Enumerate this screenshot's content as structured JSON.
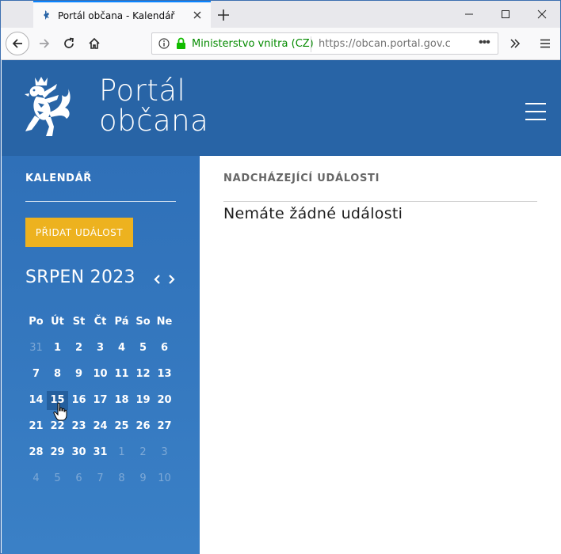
{
  "browser": {
    "tab_title": "Portál občana - Kalendář",
    "site_owner": "Ministerstvo vnitra (CZ)",
    "url": "https://obcan.portal.gov.cz/",
    "more_dots": "•••"
  },
  "header": {
    "title_line1": "Portál",
    "title_line2": "občana"
  },
  "sidebar": {
    "heading": "KALENDÁŘ",
    "add_button": "PŘIDAT UDÁLOST",
    "month_label": "SRPEN 2023",
    "weekdays": [
      "Po",
      "Út",
      "St",
      "Čt",
      "Pá",
      "So",
      "Ne"
    ],
    "weeks": [
      [
        {
          "d": "31",
          "m": true
        },
        {
          "d": "1"
        },
        {
          "d": "2"
        },
        {
          "d": "3"
        },
        {
          "d": "4"
        },
        {
          "d": "5"
        },
        {
          "d": "6"
        }
      ],
      [
        {
          "d": "7"
        },
        {
          "d": "8"
        },
        {
          "d": "9"
        },
        {
          "d": "10"
        },
        {
          "d": "11"
        },
        {
          "d": "12"
        },
        {
          "d": "13"
        }
      ],
      [
        {
          "d": "14"
        },
        {
          "d": "15",
          "sel": true
        },
        {
          "d": "16"
        },
        {
          "d": "17"
        },
        {
          "d": "18"
        },
        {
          "d": "19"
        },
        {
          "d": "20"
        }
      ],
      [
        {
          "d": "21"
        },
        {
          "d": "22"
        },
        {
          "d": "23"
        },
        {
          "d": "24"
        },
        {
          "d": "25"
        },
        {
          "d": "26"
        },
        {
          "d": "27"
        }
      ],
      [
        {
          "d": "28"
        },
        {
          "d": "29"
        },
        {
          "d": "30"
        },
        {
          "d": "31"
        },
        {
          "d": "1",
          "m": true
        },
        {
          "d": "2",
          "m": true
        },
        {
          "d": "3",
          "m": true
        }
      ],
      [
        {
          "d": "4",
          "m": true
        },
        {
          "d": "5",
          "m": true
        },
        {
          "d": "6",
          "m": true
        },
        {
          "d": "7",
          "m": true
        },
        {
          "d": "8",
          "m": true
        },
        {
          "d": "9",
          "m": true
        },
        {
          "d": "10",
          "m": true
        }
      ]
    ]
  },
  "main": {
    "heading": "NADCHÁZEJÍCÍ UDÁLOSTI",
    "empty_message": "Nemáte žádné události"
  },
  "colors": {
    "header_blue": "#2864a6",
    "sidebar_blue": "#2f70b8",
    "accent_yellow": "#edb21f",
    "secure_green": "#058b00"
  },
  "icons": [
    "lion-logo-icon",
    "hamburger-menu-icon",
    "chevron-left-icon",
    "chevron-right-icon",
    "lock-icon",
    "info-icon",
    "back-icon",
    "forward-icon",
    "reload-icon",
    "home-icon",
    "overflow-icon",
    "menu-icon",
    "close-icon",
    "minimize-icon",
    "maximize-icon",
    "new-tab-icon"
  ]
}
